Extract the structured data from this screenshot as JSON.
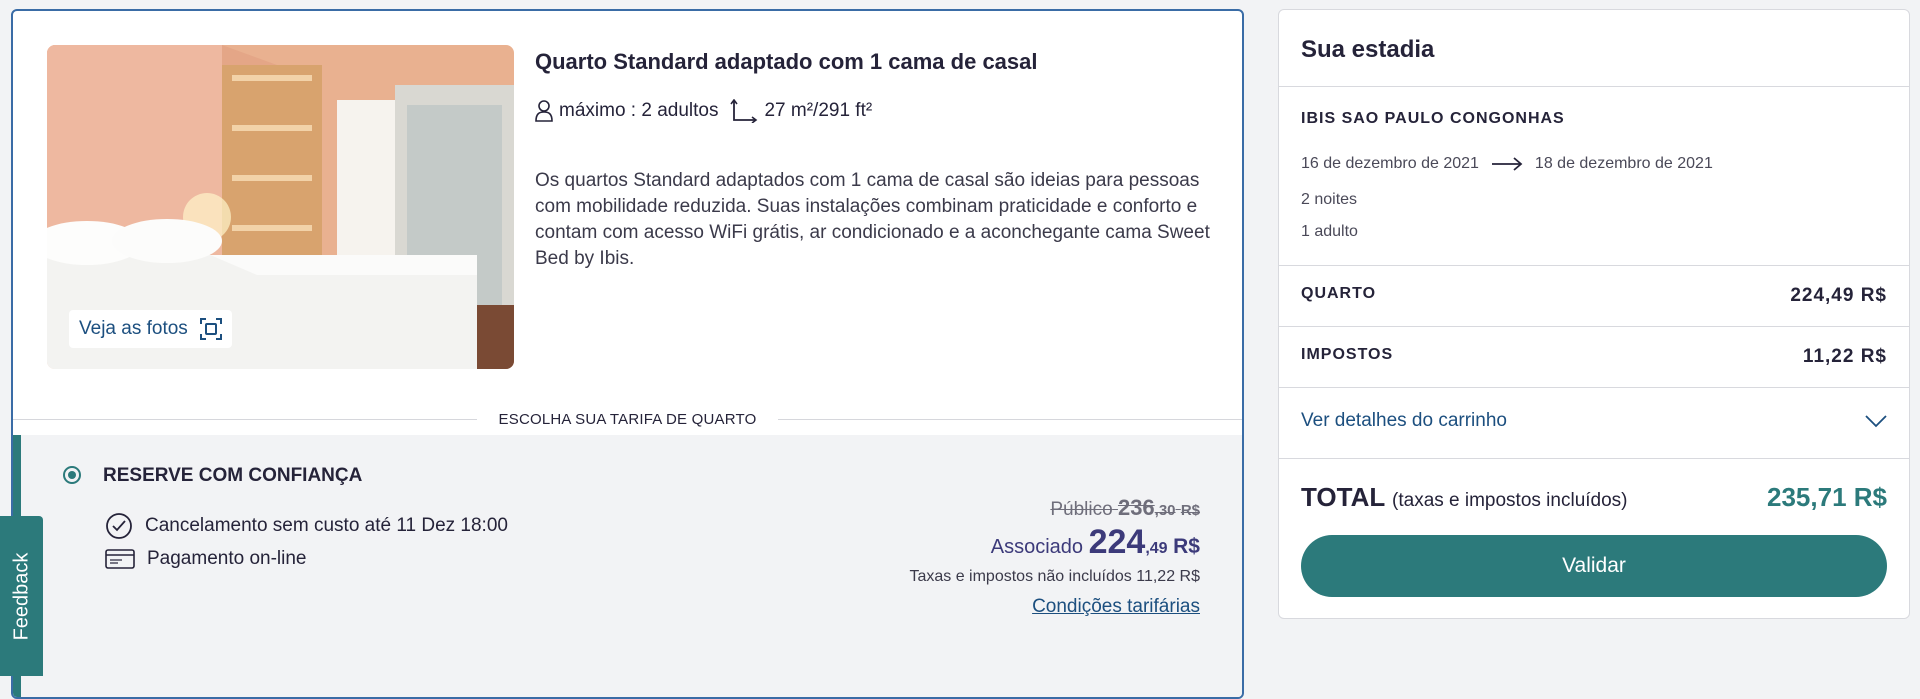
{
  "room": {
    "title": "Quarto Standard adaptado com 1 cama de casal",
    "occupancy": "máximo : 2 adultos",
    "area": "27 m²/291 ft²",
    "description": "Os quartos Standard adaptados com 1 cama de casal são ideias para pessoas com mobilidade reduzida. Suas instalações combinam praticidade e conforto e contam com acesso WiFi grátis, ar condicionado e a aconchegante cama Sweet Bed by Ibis.",
    "photos_button": "Veja as fotos"
  },
  "rate_section": {
    "heading": "ESCOLHA SUA TARIFA DE QUARTO",
    "rate_name": "RESERVE COM CONFIANÇA",
    "features": [
      "Cancelamento sem custo até 11 Dez 18:00",
      "Pagamento on-line"
    ],
    "public_label": "Público",
    "public_amount": "236",
    "public_cents": ",30",
    "public_currency": "R$",
    "member_label": "Associado",
    "member_amount": "224",
    "member_cents": ",49",
    "member_currency": "R$",
    "tax_note": "Taxas e impostos não incluídos 11,22 R$",
    "conditions_link": "Condições tarifárias"
  },
  "feedback": {
    "label": "Feedback"
  },
  "summary": {
    "title": "Sua estadia",
    "hotel": "IBIS SAO PAULO CONGONHAS",
    "date_from": "16 de dezembro de 2021",
    "date_to": "18 de dezembro de 2021",
    "nights": "2 noites",
    "adults": "1 adulto",
    "room_label": "QUARTO",
    "room_value": "224,49 R$",
    "taxes_label": "IMPOSTOS",
    "taxes_value": "11,22 R$",
    "cart_details": "Ver detalhes do carrinho",
    "total_label": "TOTAL",
    "total_note": "(taxas e impostos incluídos)",
    "total_value": "235,71 R$",
    "validate_button": "Validar"
  },
  "colors": {
    "accent_teal": "#2c7a7b",
    "link_blue": "#1c4f7f",
    "member_price": "#3c3a7a",
    "card_border": "#3a6ca6"
  }
}
